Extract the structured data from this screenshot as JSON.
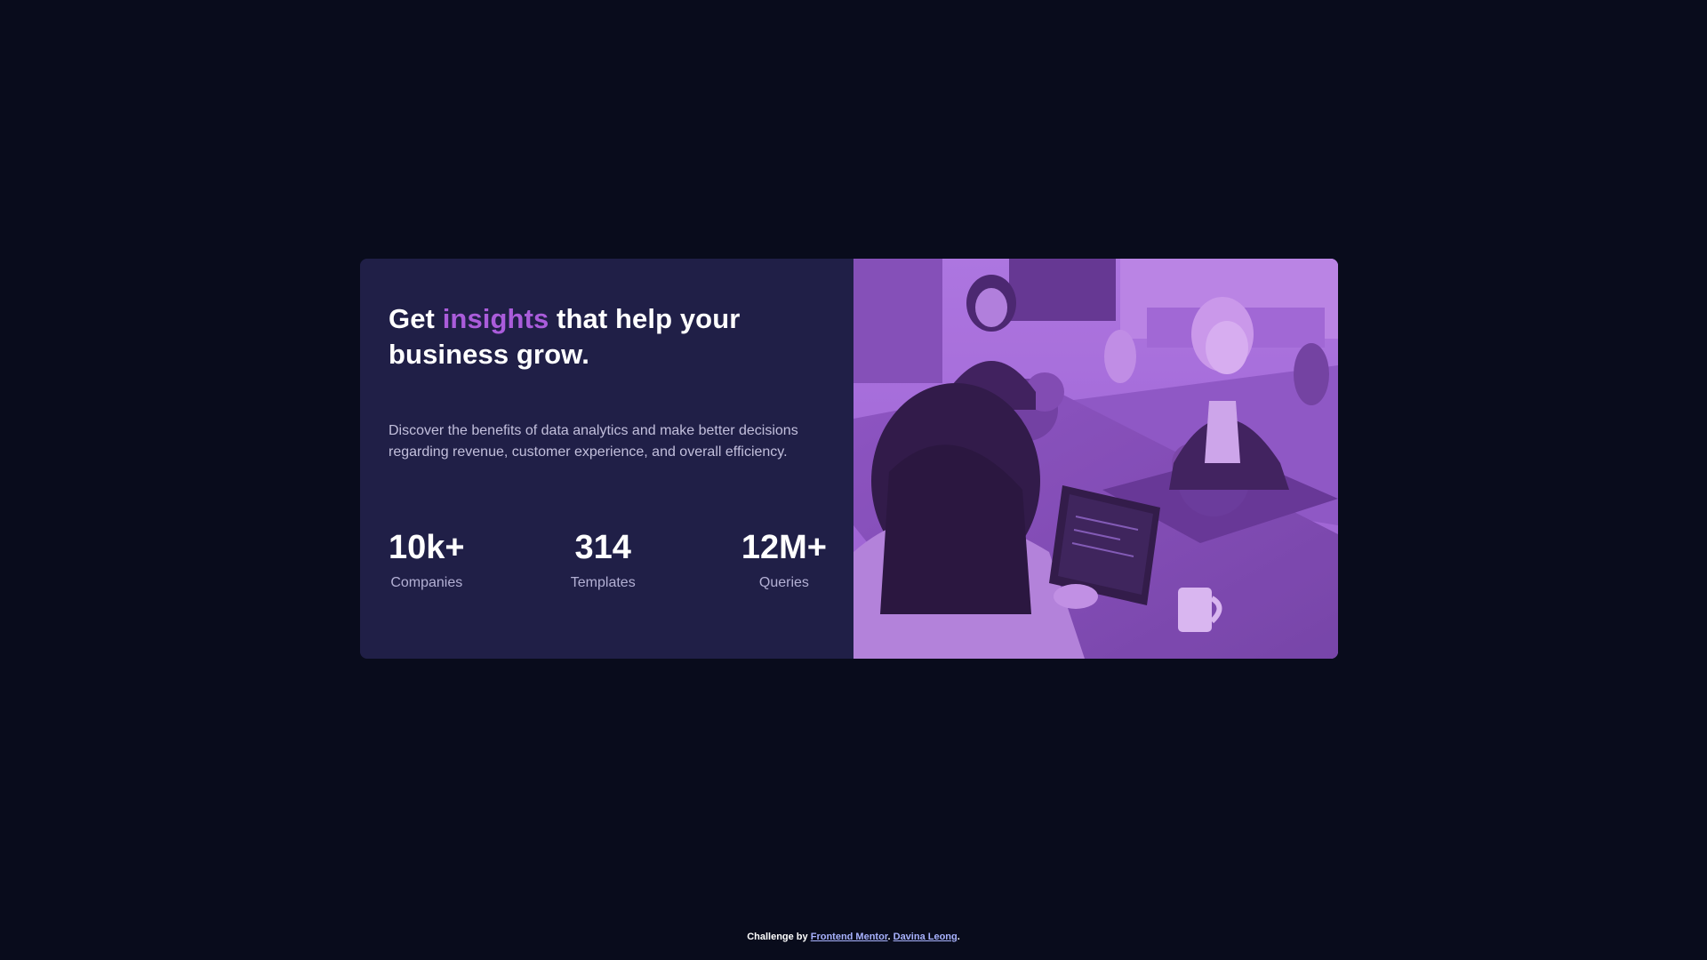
{
  "hero": {
    "headline_before": "Get ",
    "headline_accent": "insights",
    "headline_after": " that help your business grow.",
    "description": "Discover the benefits of data analytics and make better decisions regarding revenue, customer experience, and overall efficiency."
  },
  "stats": [
    {
      "value": "10k+",
      "label": "Companies"
    },
    {
      "value": "314",
      "label": "Templates"
    },
    {
      "value": "12M+",
      "label": "Queries"
    }
  ],
  "image": {
    "icon": "team-working-photo-icon"
  },
  "footer": {
    "prefix": "Challenge by ",
    "link1": "Frontend Mentor",
    "separator": ". ",
    "link2": "Davina Leong",
    "suffix": "."
  },
  "colors": {
    "background": "#090c1c",
    "card": "#201f47",
    "accent": "#aa5cdb",
    "image_tint": "#a064d5"
  }
}
